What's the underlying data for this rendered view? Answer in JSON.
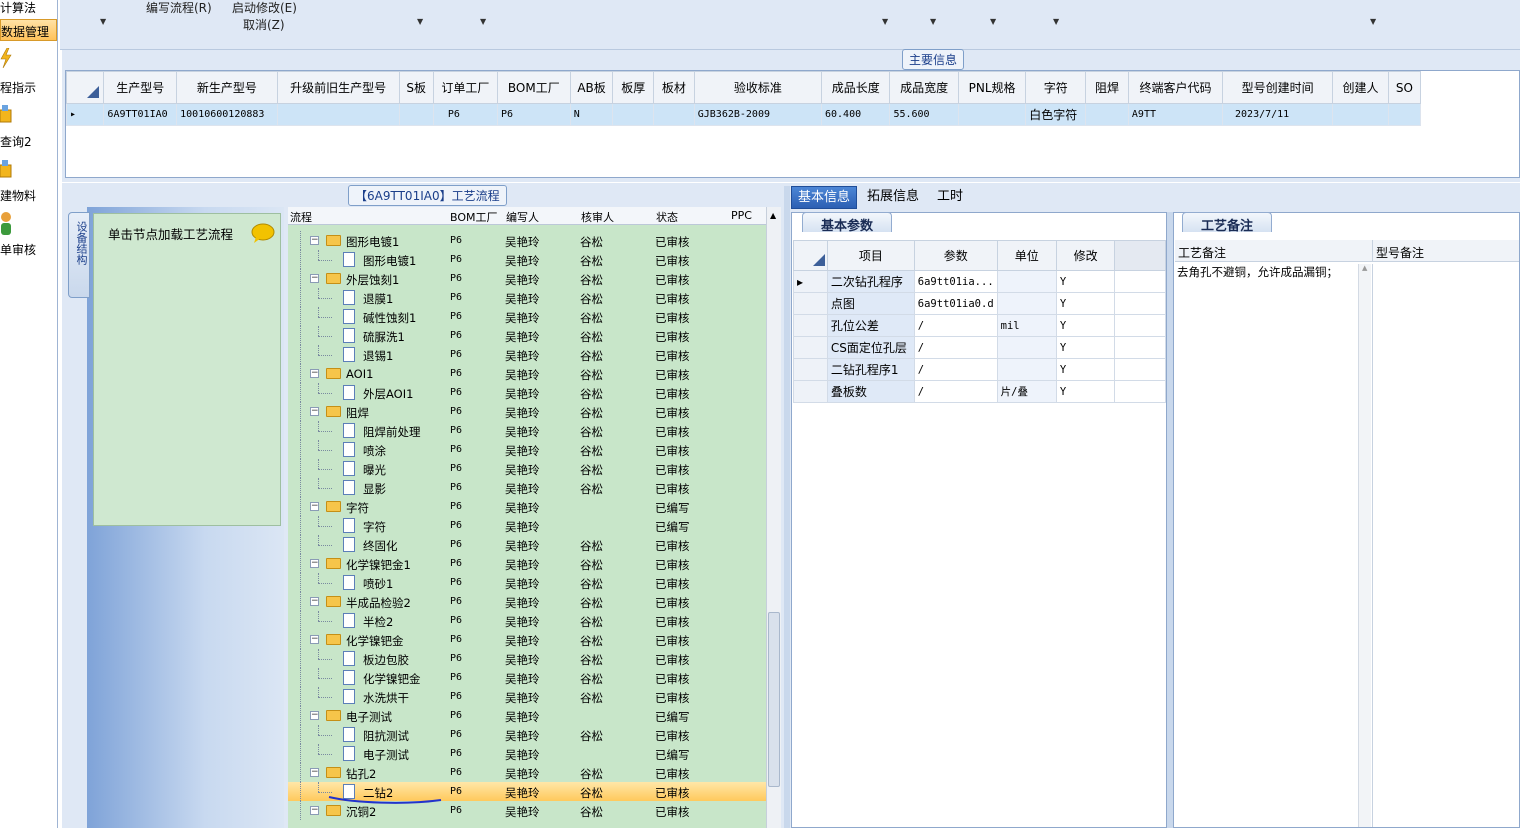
{
  "left_nav": {
    "items": [
      {
        "label": "计算法"
      },
      {
        "label": "数据管理"
      },
      {
        "label": "程指示"
      },
      {
        "label": "查询2"
      },
      {
        "label": "建物料"
      },
      {
        "label": "单审核"
      }
    ]
  },
  "toolbar": {
    "edit_flow": "编写流程(R)",
    "start_modify": "启动修改(E)",
    "cancel": "取消(Z)"
  },
  "main_info": {
    "title": "主要信息",
    "columns": [
      "生产型号",
      "新生产型号",
      "升级前旧生产型号",
      "S板",
      "订单工厂",
      "BOM工厂",
      "AB板",
      "板厚",
      "板材",
      "验收标准",
      "成品长度",
      "成品宽度",
      "PNL规格",
      "字符",
      "阻焊",
      "终端客户代码",
      "型号创建时间",
      "创建人",
      "SO"
    ],
    "rows": [
      [
        "6A9TT01IA0",
        "10010600120883",
        "",
        "",
        "P6",
        "P6",
        "N",
        "",
        "",
        "GJB362B-2009",
        "60.400",
        "55.600",
        "",
        "白色字符",
        "",
        "A9TT",
        "2023/7/11",
        "",
        ""
      ]
    ]
  },
  "flow": {
    "title": "【6A9TT01IA0】工艺流程",
    "side_tab": "设备结构",
    "load_hint": "单击节点加载工艺流程",
    "columns": [
      "流程",
      "BOM工厂",
      "编写人",
      "核审人",
      "状态",
      "PPC"
    ],
    "rows": [
      {
        "level": 1,
        "type": "folder",
        "name": "图形电镀1",
        "bom": "P6",
        "writer": "吴艳玲",
        "reviewer": "谷松",
        "status": "已审核"
      },
      {
        "level": 2,
        "type": "doc",
        "name": "图形电镀1",
        "bom": "P6",
        "writer": "吴艳玲",
        "reviewer": "谷松",
        "status": "已审核"
      },
      {
        "level": 1,
        "type": "folder",
        "name": "外层蚀刻1",
        "bom": "P6",
        "writer": "吴艳玲",
        "reviewer": "谷松",
        "status": "已审核"
      },
      {
        "level": 2,
        "type": "doc",
        "name": "退膜1",
        "bom": "P6",
        "writer": "吴艳玲",
        "reviewer": "谷松",
        "status": "已审核"
      },
      {
        "level": 2,
        "type": "doc",
        "name": "碱性蚀刻1",
        "bom": "P6",
        "writer": "吴艳玲",
        "reviewer": "谷松",
        "status": "已审核"
      },
      {
        "level": 2,
        "type": "doc",
        "name": "硫脲洗1",
        "bom": "P6",
        "writer": "吴艳玲",
        "reviewer": "谷松",
        "status": "已审核"
      },
      {
        "level": 2,
        "type": "doc",
        "name": "退锡1",
        "bom": "P6",
        "writer": "吴艳玲",
        "reviewer": "谷松",
        "status": "已审核"
      },
      {
        "level": 1,
        "type": "folder",
        "name": "AOI1",
        "bom": "P6",
        "writer": "吴艳玲",
        "reviewer": "谷松",
        "status": "已审核"
      },
      {
        "level": 2,
        "type": "doc",
        "name": "外层AOI1",
        "bom": "P6",
        "writer": "吴艳玲",
        "reviewer": "谷松",
        "status": "已审核"
      },
      {
        "level": 1,
        "type": "folder",
        "name": "阻焊",
        "bom": "P6",
        "writer": "吴艳玲",
        "reviewer": "谷松",
        "status": "已审核"
      },
      {
        "level": 2,
        "type": "doc",
        "name": "阻焊前处理",
        "bom": "P6",
        "writer": "吴艳玲",
        "reviewer": "谷松",
        "status": "已审核"
      },
      {
        "level": 2,
        "type": "doc",
        "name": "喷涂",
        "bom": "P6",
        "writer": "吴艳玲",
        "reviewer": "谷松",
        "status": "已审核"
      },
      {
        "level": 2,
        "type": "doc",
        "name": "曝光",
        "bom": "P6",
        "writer": "吴艳玲",
        "reviewer": "谷松",
        "status": "已审核"
      },
      {
        "level": 2,
        "type": "doc",
        "name": "显影",
        "bom": "P6",
        "writer": "吴艳玲",
        "reviewer": "谷松",
        "status": "已审核"
      },
      {
        "level": 1,
        "type": "folder",
        "name": "字符",
        "bom": "P6",
        "writer": "吴艳玲",
        "reviewer": "",
        "status": "已编写"
      },
      {
        "level": 2,
        "type": "doc",
        "name": "字符",
        "bom": "P6",
        "writer": "吴艳玲",
        "reviewer": "",
        "status": "已编写"
      },
      {
        "level": 2,
        "type": "doc",
        "name": "终固化",
        "bom": "P6",
        "writer": "吴艳玲",
        "reviewer": "谷松",
        "status": "已审核"
      },
      {
        "level": 1,
        "type": "folder",
        "name": "化学镍钯金1",
        "bom": "P6",
        "writer": "吴艳玲",
        "reviewer": "谷松",
        "status": "已审核"
      },
      {
        "level": 2,
        "type": "doc",
        "name": "喷砂1",
        "bom": "P6",
        "writer": "吴艳玲",
        "reviewer": "谷松",
        "status": "已审核"
      },
      {
        "level": 1,
        "type": "folder",
        "name": "半成品检验2",
        "bom": "P6",
        "writer": "吴艳玲",
        "reviewer": "谷松",
        "status": "已审核"
      },
      {
        "level": 2,
        "type": "doc",
        "name": "半检2",
        "bom": "P6",
        "writer": "吴艳玲",
        "reviewer": "谷松",
        "status": "已审核"
      },
      {
        "level": 1,
        "type": "folder",
        "name": "化学镍钯金",
        "bom": "P6",
        "writer": "吴艳玲",
        "reviewer": "谷松",
        "status": "已审核"
      },
      {
        "level": 2,
        "type": "doc",
        "name": "板边包胶",
        "bom": "P6",
        "writer": "吴艳玲",
        "reviewer": "谷松",
        "status": "已审核"
      },
      {
        "level": 2,
        "type": "doc",
        "name": "化学镍钯金",
        "bom": "P6",
        "writer": "吴艳玲",
        "reviewer": "谷松",
        "status": "已审核"
      },
      {
        "level": 2,
        "type": "doc",
        "name": "水洗烘干",
        "bom": "P6",
        "writer": "吴艳玲",
        "reviewer": "谷松",
        "status": "已审核"
      },
      {
        "level": 1,
        "type": "folder",
        "name": "电子测试",
        "bom": "P6",
        "writer": "吴艳玲",
        "reviewer": "",
        "status": "已编写"
      },
      {
        "level": 2,
        "type": "doc",
        "name": "阻抗测试",
        "bom": "P6",
        "writer": "吴艳玲",
        "reviewer": "谷松",
        "status": "已审核"
      },
      {
        "level": 2,
        "type": "doc",
        "name": "电子测试",
        "bom": "P6",
        "writer": "吴艳玲",
        "reviewer": "",
        "status": "已编写"
      },
      {
        "level": 1,
        "type": "folder",
        "name": "钻孔2",
        "bom": "P6",
        "writer": "吴艳玲",
        "reviewer": "谷松",
        "status": "已审核"
      },
      {
        "level": 2,
        "type": "doc",
        "name": "二钻2",
        "bom": "P6",
        "writer": "吴艳玲",
        "reviewer": "谷松",
        "status": "已审核",
        "selected": true
      },
      {
        "level": 1,
        "type": "folder",
        "name": "沉铜2",
        "bom": "P6",
        "writer": "吴艳玲",
        "reviewer": "谷松",
        "status": "已审核"
      }
    ]
  },
  "right_tabs": [
    "基本信息",
    "拓展信息",
    "工时"
  ],
  "basic": {
    "title": "基本参数",
    "columns": [
      "项目",
      "参数",
      "单位",
      "修改"
    ],
    "rows": [
      [
        "二次钻孔程序",
        "6a9tt01ia...",
        "",
        "Y"
      ],
      [
        "点图",
        "6a9tt01ia0.d",
        "",
        "Y"
      ],
      [
        "孔位公差",
        "/",
        "mil",
        "Y"
      ],
      [
        "CS面定位孔层",
        "/",
        "",
        "Y"
      ],
      [
        "二钻孔程序1",
        "/",
        "",
        "Y"
      ],
      [
        "叠板数",
        "/",
        "片/叠",
        "Y"
      ]
    ]
  },
  "notes": {
    "title": "工艺备注",
    "col1": "工艺备注",
    "col2": "型号备注",
    "note_text": "去角孔不避铜，允许成品漏铜；"
  }
}
